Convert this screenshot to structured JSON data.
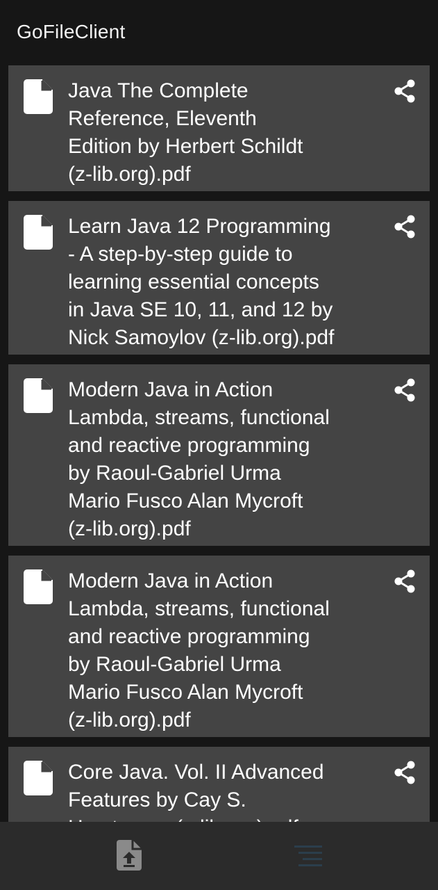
{
  "app": {
    "title": "GoFileClient"
  },
  "files": [
    {
      "name": "Java The Complete\nReference, Eleventh\nEdition by Herbert Schildt\n(z-lib.org).pdf",
      "icon": "file-icon",
      "action_icon": "share-icon"
    },
    {
      "name": "Learn Java 12 Programming\n- A step-by-step guide to\nlearning essential concepts\nin Java SE 10, 11, and 12 by\nNick Samoylov (z-lib.org).pdf",
      "icon": "file-icon",
      "action_icon": "share-icon"
    },
    {
      "name": "Modern Java in Action\nLambda, streams, functional\nand reactive programming\nby Raoul-Gabriel Urma\nMario Fusco Alan Mycroft\n(z-lib.org).pdf",
      "icon": "file-icon",
      "action_icon": "share-icon"
    },
    {
      "name": "Modern Java in Action\nLambda, streams, functional\nand reactive programming\nby Raoul-Gabriel Urma\nMario Fusco Alan Mycroft\n(z-lib.org).pdf",
      "icon": "file-icon",
      "action_icon": "share-icon"
    },
    {
      "name": "Core Java. Vol. II Advanced\nFeatures by Cay S.\nHorstmann (z-lib.org).pdf",
      "icon": "file-icon",
      "action_icon": "share-icon"
    }
  ],
  "bottom_nav": {
    "items": [
      {
        "icon": "upload-file-icon",
        "active": false
      },
      {
        "icon": "list-icon",
        "active": true
      }
    ]
  },
  "colors": {
    "background": "#161616",
    "card": "#444444",
    "bottom_nav": "#2b2b2b",
    "active_nav_icon": "#2b3e4c",
    "inactive_nav_icon": "#8a8a8a"
  }
}
